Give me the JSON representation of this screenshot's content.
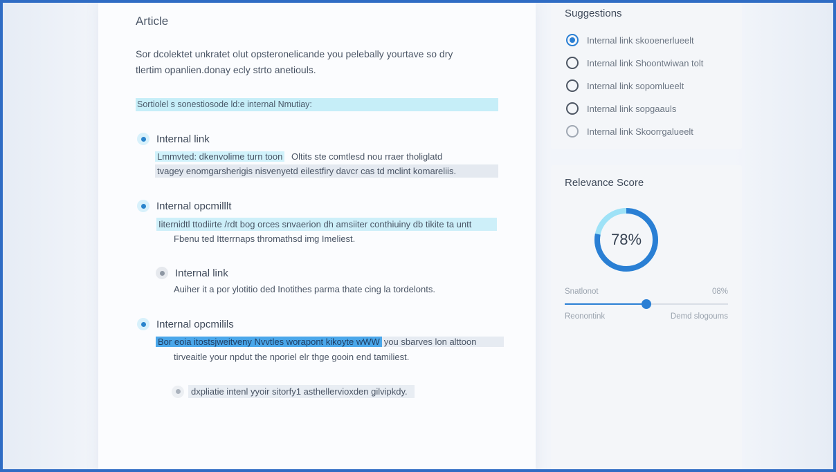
{
  "article": {
    "title": "Article",
    "intro_line1": "Sor dcolektet unkratet olut opsteronelicande you pelebally yourtave so dry",
    "intro_line2": "tlertim opanlien.donay ecly strto anetiouls.",
    "highlight_bar": "Sortiolel s sonestiosode ld:e internal Nmutiay:",
    "items": [
      {
        "title": "Internal link",
        "line1_box": "Lmmvted: dkenvolime turn toon",
        "line1_rest": "Oltits ste comtlesd nou rraer tholiglatd",
        "line2": "tvagey enomgarsherigis nisvenyetd eilestfiry davcr cas td mclint komareliis."
      },
      {
        "title": "Internal opcmilllt",
        "line1": "Iiternidtl ttodiirte /rdt bog orces snvaerion dh amsiiter conthiuiny db tikite ta untt",
        "line2": "Fbenu ted Itterrnaps thromathsd img Imeliest."
      },
      {
        "title": "Internal link",
        "line1": "Auiher it a por ylotitio ded Inotithes parma thate cing la tordelonts."
      },
      {
        "title": "Internal opcmilils",
        "line1_box": "Bor eoia itostsjweitveny Nvvtles worapont kikoyte wWW",
        "line1_rest": "you sbarves lon alttoon",
        "line2": "tirveaitle your npdut the nporiel elr thge gooin end tamiliest."
      },
      {
        "line1": "dxpliatie intenl yyoir sitorfy1 asthellervioxden gilvipkdy."
      }
    ]
  },
  "suggestions": {
    "title": "Suggestions",
    "options": [
      {
        "label": "Internal link skooenerlueelt",
        "state": "checked"
      },
      {
        "label": "Internal link Shoontwiwan tolt",
        "state": "unchecked"
      },
      {
        "label": "Internal link sopomlueelt",
        "state": "unchecked"
      },
      {
        "label": "Internal link sopgaauls",
        "state": "unchecked"
      },
      {
        "label": "Internal link Skoorrgalueelt",
        "state": "faded"
      }
    ]
  },
  "relevance": {
    "title": "Relevance Score",
    "score_label": "78%",
    "score_value": 0.78,
    "slider_left_label": "Snatlonot",
    "slider_right_value": "08%",
    "slider_value": 0.5,
    "bottom_left": "Reonontink",
    "bottom_right": "Demd slogoums"
  },
  "colors": {
    "accent": "#2a7fd4",
    "ring_light": "#9ee2f7",
    "highlight_cyan": "#c6eef8",
    "highlight_blue": "#4aa7ea"
  }
}
